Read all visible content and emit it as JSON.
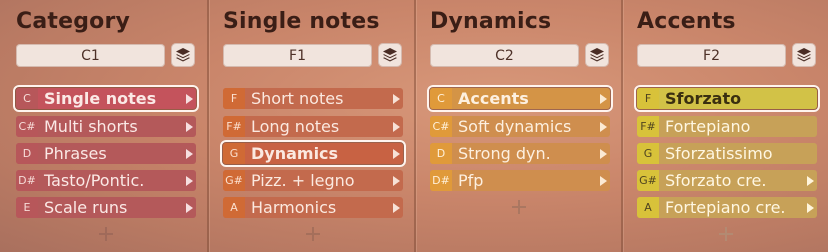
{
  "colors": {
    "category": "#b4595a",
    "single_notes": "#c36a4d",
    "dynamics": "#cf8e4e",
    "accents": "#d2c247"
  },
  "columns": [
    {
      "title": "Category",
      "key": "C1",
      "items": [
        {
          "key": "C",
          "label": "Single notes",
          "selected": true
        },
        {
          "key": "C#",
          "label": "Multi shorts"
        },
        {
          "key": "D",
          "label": "Phrases"
        },
        {
          "key": "D#",
          "label": "Tasto/Pontic."
        },
        {
          "key": "E",
          "label": "Scale runs"
        }
      ]
    },
    {
      "title": "Single notes",
      "key": "F1",
      "items": [
        {
          "key": "F",
          "label": "Short notes"
        },
        {
          "key": "F#",
          "label": "Long notes"
        },
        {
          "key": "G",
          "label": "Dynamics",
          "selected": true
        },
        {
          "key": "G#",
          "label": "Pizz. + legno"
        },
        {
          "key": "A",
          "label": "Harmonics"
        }
      ]
    },
    {
      "title": "Dynamics",
      "key": "C2",
      "items": [
        {
          "key": "C",
          "label": "Accents",
          "selected": true
        },
        {
          "key": "C#",
          "label": "Soft dynamics"
        },
        {
          "key": "D",
          "label": "Strong dyn."
        },
        {
          "key": "D#",
          "label": "Pfp"
        }
      ]
    },
    {
      "title": "Accents",
      "key": "F2",
      "items": [
        {
          "key": "F",
          "label": "Sforzato",
          "selected": true
        },
        {
          "key": "F#",
          "label": "Fortepiano"
        },
        {
          "key": "G",
          "label": "Sforzatissimo"
        },
        {
          "key": "G#",
          "label": "Sforzato cre."
        },
        {
          "key": "A",
          "label": "Fortepiano cre."
        }
      ]
    }
  ],
  "icons": {
    "layers": "layers-icon",
    "arrow": "chevron-right-icon",
    "add": "plus-icon"
  }
}
